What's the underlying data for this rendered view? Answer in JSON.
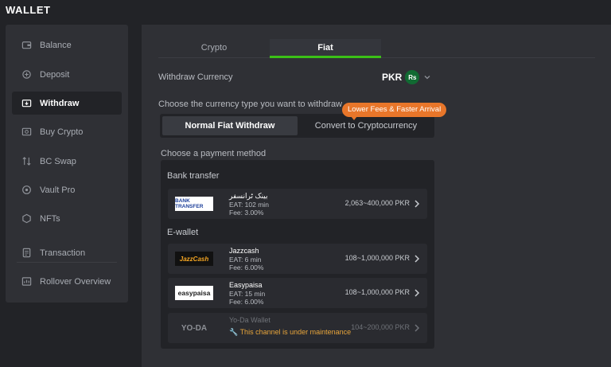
{
  "app": {
    "title": "WALLET"
  },
  "sidebar": {
    "items": [
      {
        "label": "Balance",
        "icon": "wallet-icon"
      },
      {
        "label": "Deposit",
        "icon": "deposit-icon"
      },
      {
        "label": "Withdraw",
        "icon": "withdraw-icon",
        "active": true
      },
      {
        "label": "Buy Crypto",
        "icon": "buy-crypto-icon"
      },
      {
        "label": "BC Swap",
        "icon": "swap-icon"
      },
      {
        "label": "Vault Pro",
        "icon": "vault-icon"
      },
      {
        "label": "NFTs",
        "icon": "nft-icon"
      },
      {
        "label": "Transaction",
        "icon": "transaction-icon"
      },
      {
        "label": "Rollover Overview",
        "icon": "rollover-icon"
      }
    ]
  },
  "main": {
    "tabs": [
      {
        "label": "Crypto"
      },
      {
        "label": "Fiat",
        "active": true
      }
    ],
    "withdraw_currency": {
      "label": "Withdraw Currency",
      "code": "PKR",
      "symbol": "Rs"
    },
    "currency_type": {
      "label": "Choose the currency type you want to withdraw",
      "options": [
        "Normal Fiat Withdraw",
        "Convert to Cryptocurrency"
      ],
      "selected": "Normal Fiat Withdraw",
      "promo": "Lower Fees & Faster Arrival"
    },
    "payment": {
      "label": "Choose a payment method",
      "groups": [
        {
          "label": "Bank transfer",
          "methods": [
            {
              "logo": "BANK TRANSFER",
              "name": "بینک ٹرانسفر",
              "eat": "EAT: 102 min",
              "fee": "Fee: 3.00%",
              "range": "2,063~400,000 PKR"
            }
          ]
        },
        {
          "label": "E-wallet",
          "methods": [
            {
              "logo": "JazzCash",
              "name": "Jazzcash",
              "eat": "EAT: 6 min",
              "fee": "Fee: 6.00%",
              "range": "108~1,000,000 PKR"
            },
            {
              "logo": "easypaisa",
              "name": "Easypaisa",
              "eat": "EAT: 15 min",
              "fee": "Fee: 6.00%",
              "range": "108~1,000,000 PKR"
            },
            {
              "logo": "YO-DA",
              "name": "Yo-Da Wallet",
              "maintenance": "This channel is under maintenance",
              "range": "104~200,000 PKR"
            }
          ]
        }
      ]
    }
  },
  "colors": {
    "accent": "#3bc117",
    "promo": "#e8762a",
    "warning": "#e8a53b"
  }
}
